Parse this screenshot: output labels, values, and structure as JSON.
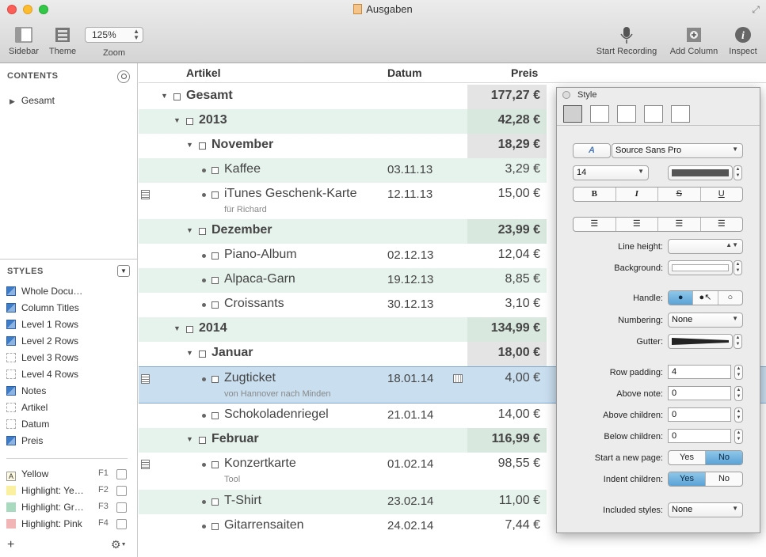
{
  "window": {
    "title": "Ausgaben"
  },
  "toolbar": {
    "sidebar": "Sidebar",
    "theme": "Theme",
    "zoom_value": "125%",
    "zoom_label": "Zoom",
    "start_recording": "Start Recording",
    "add_column": "Add Column",
    "inspect": "Inspect"
  },
  "sidebar": {
    "contents_heading": "CONTENTS",
    "tree_item": "Gesamt",
    "styles_heading": "STYLES",
    "styles": [
      "Whole Docu…",
      "Column Titles",
      "Level 1 Rows",
      "Level 2 Rows",
      "Level 3 Rows",
      "Level 4 Rows",
      "Notes",
      "Artikel",
      "Datum",
      "Preis"
    ],
    "highlights": [
      {
        "label": "Yellow",
        "key": "F1"
      },
      {
        "label": "Highlight: Ye…",
        "key": "F2"
      },
      {
        "label": "Highlight: Gr…",
        "key": "F3"
      },
      {
        "label": "Highlight: Pink",
        "key": "F4"
      }
    ]
  },
  "columns": {
    "artikel": "Artikel",
    "datum": "Datum",
    "preis": "Preis"
  },
  "rows": [
    {
      "text": "Gesamt",
      "price": "177,27 €"
    },
    {
      "text": "2013",
      "price": "42,28 €"
    },
    {
      "text": "November",
      "price": "18,29 €"
    },
    {
      "text": "Kaffee",
      "date": "03.11.13",
      "price": "3,29 €"
    },
    {
      "text": "iTunes Geschenk-Karte",
      "note": "für Richard",
      "date": "12.11.13",
      "price": "15,00 €"
    },
    {
      "text": "Dezember",
      "price": "23,99 €"
    },
    {
      "text": "Piano-Album",
      "date": "02.12.13",
      "price": "12,04 €"
    },
    {
      "text": "Alpaca-Garn",
      "date": "19.12.13",
      "price": "8,85 €"
    },
    {
      "text": "Croissants",
      "date": "30.12.13",
      "price": "3,10 €"
    },
    {
      "text": "2014",
      "price": "134,99 €"
    },
    {
      "text": "Januar",
      "price": "18,00 €"
    },
    {
      "text": "Zugticket",
      "note": "von Hannover nach Minden",
      "date": "18.01.14",
      "price": "4,00 €"
    },
    {
      "text": "Schokoladenriegel",
      "date": "21.01.14",
      "price": "14,00 €"
    },
    {
      "text": "Februar",
      "price": "116,99 €"
    },
    {
      "text": "Konzertkarte",
      "note": "Tool",
      "date": "01.02.14",
      "price": "98,55 €"
    },
    {
      "text": "T-Shirt",
      "date": "23.02.14",
      "price": "11,00 €"
    },
    {
      "text": "Gitarrensaiten",
      "date": "24.02.14",
      "price": "7,44 €"
    }
  ],
  "style_panel": {
    "title": "Style",
    "font": "Source Sans Pro",
    "size": "14",
    "bold": "B",
    "italic": "I",
    "strike": "S",
    "underline": "U",
    "line_height_label": "Line height:",
    "background_label": "Background:",
    "handle_label": "Handle:",
    "numbering_label": "Numbering:",
    "numbering_value": "None",
    "gutter_label": "Gutter:",
    "row_padding_label": "Row padding:",
    "row_padding_value": "4",
    "above_note_label": "Above note:",
    "above_note_value": "0",
    "above_children_label": "Above children:",
    "above_children_value": "0",
    "below_children_label": "Below children:",
    "below_children_value": "0",
    "start_new_page_label": "Start a new page:",
    "indent_children_label": "Indent children:",
    "yes": "Yes",
    "no": "No",
    "included_styles_label": "Included styles:",
    "included_styles_value": "None"
  }
}
